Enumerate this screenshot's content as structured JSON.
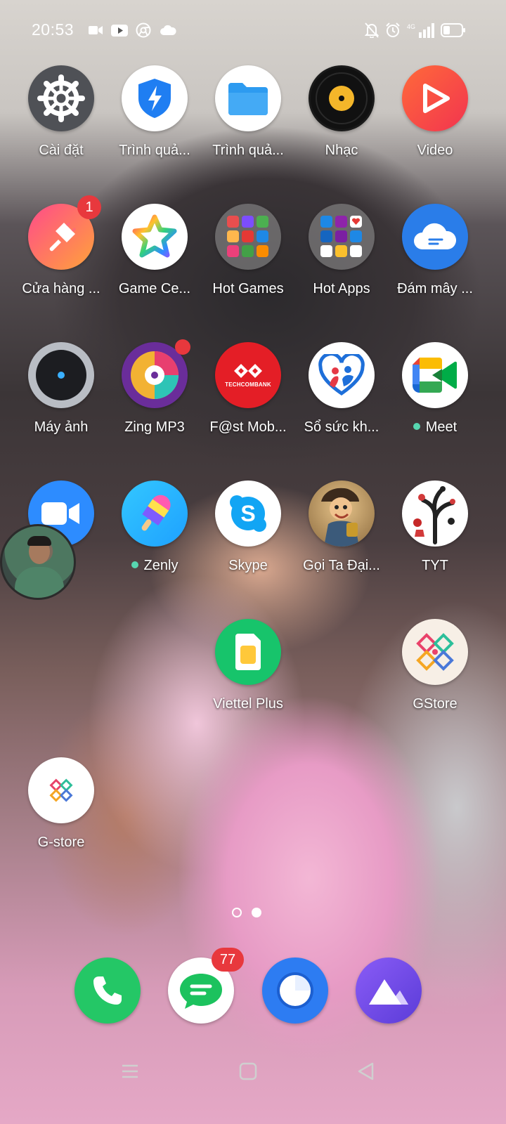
{
  "status_bar": {
    "time": "20:53",
    "left_icons": [
      "camera-record-icon",
      "youtube-icon",
      "chrome-icon",
      "cloud-icon"
    ],
    "right_icons": [
      "bell-mute-icon",
      "alarm-icon",
      "signal-4g-icon",
      "battery-icon"
    ],
    "network": "4G"
  },
  "apps": [
    {
      "label": "Cài đặt",
      "icon": "settings-gear-icon"
    },
    {
      "label": "Trình quả...",
      "icon": "security-shield-icon"
    },
    {
      "label": "Trình quả...",
      "icon": "folder-icon"
    },
    {
      "label": "Nhạc",
      "icon": "vinyl-music-icon"
    },
    {
      "label": "Video",
      "icon": "video-play-icon"
    },
    {
      "label": "Cửa hàng ...",
      "icon": "theme-brush-icon",
      "badge": "1"
    },
    {
      "label": "Game Ce...",
      "icon": "game-star-icon"
    },
    {
      "label": "Hot Games",
      "icon": "folder-grid-icon"
    },
    {
      "label": "Hot Apps",
      "icon": "folder-grid-icon"
    },
    {
      "label": "Đám mây ...",
      "icon": "cloud-app-icon"
    },
    {
      "label": "Máy ảnh",
      "icon": "camera-lens-icon"
    },
    {
      "label": "Zing MP3",
      "icon": "zing-disc-icon"
    },
    {
      "label": "F@st Mob...",
      "icon": "techcombank-icon",
      "brand_text": "TECHCOMBANK"
    },
    {
      "label": "Sổ sức kh...",
      "icon": "health-heart-icon"
    },
    {
      "label": "Meet",
      "icon": "meet-video-icon"
    },
    {
      "label": "",
      "icon": "zoom-camera-icon"
    },
    {
      "label": "Zenly",
      "icon": "zenly-popsicle-icon"
    },
    {
      "label": "Skype",
      "icon": "skype-icon"
    },
    {
      "label": "Gọi Ta Đại...",
      "icon": "game-character-icon"
    },
    {
      "label": "TYT",
      "icon": "tree-art-icon"
    },
    {
      "label": "Viettel Plus",
      "icon": "sim-card-icon"
    },
    {
      "label": "GStore",
      "icon": "gstore-pattern-icon"
    },
    {
      "label": "G-store",
      "icon": "gstore-pattern-icon"
    }
  ],
  "dock": [
    {
      "name": "Phone",
      "icon": "phone-icon"
    },
    {
      "name": "Messages",
      "icon": "message-icon",
      "badge": "77"
    },
    {
      "name": "Browser",
      "icon": "browser-icon"
    },
    {
      "name": "Photos",
      "icon": "photos-icon"
    }
  ],
  "pager": {
    "pages": 2,
    "current": 2
  },
  "floating_bubble": {
    "icon": "avatar-chat-head"
  },
  "colors": {
    "badge": "#e8383d",
    "live_dot": "#57d6b0"
  }
}
